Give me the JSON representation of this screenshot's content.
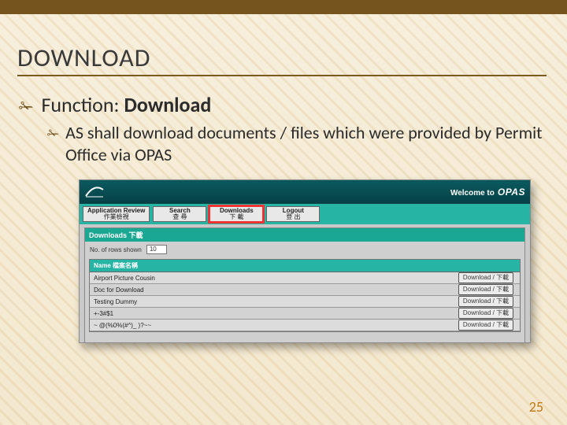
{
  "slide": {
    "title": "DOWNLOAD",
    "bullet1_label": "Function:",
    "bullet1_value": "Download",
    "bullet2_text": "AS shall download documents / files which were provided by Permit Office via OPAS",
    "page_number": "25"
  },
  "app": {
    "welcome_prefix": "Welcome to",
    "app_name": "OPAS",
    "nav": [
      {
        "en": "Application Review",
        "zh": "作業檢視",
        "highlight": false
      },
      {
        "en": "Search",
        "zh": "查 尋",
        "highlight": false
      },
      {
        "en": "Downloads",
        "zh": "下 載",
        "highlight": true
      },
      {
        "en": "Logout",
        "zh": "登 出",
        "highlight": false
      }
    ],
    "panel_title": "Downloads 下載",
    "rows_label": "No. of rows shown",
    "rows_value": "10",
    "grid_header": "Name 檔案名稱",
    "action_label": "Download / 下載",
    "rows": [
      {
        "name": "Airport Picture Cousin"
      },
      {
        "name": "Doc for Download"
      },
      {
        "name": "Testing Dummy"
      },
      {
        "name": "+-3#$1"
      },
      {
        "name": "~ @(%0%(#^)_ )?~~"
      }
    ]
  }
}
